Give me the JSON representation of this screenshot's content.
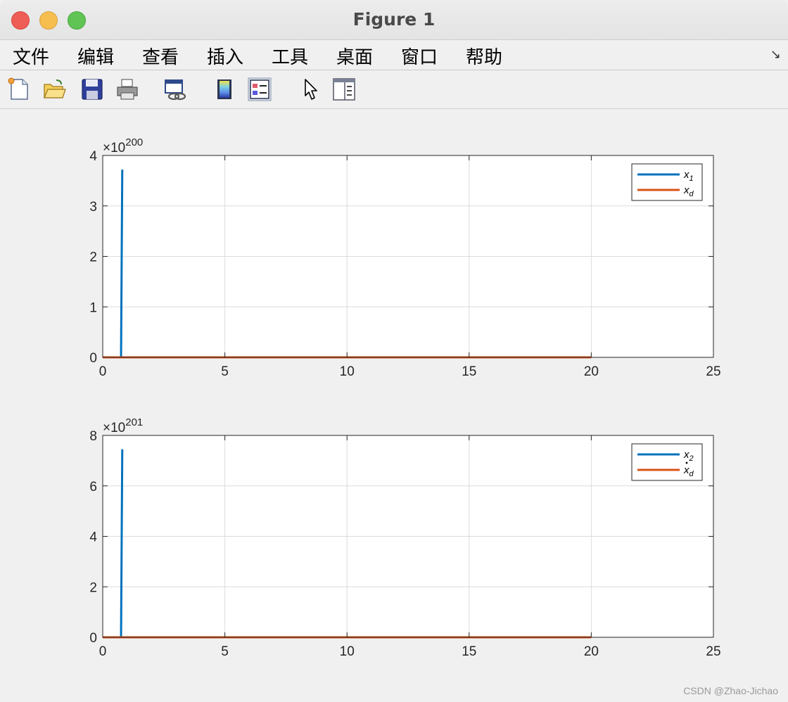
{
  "window": {
    "title": "Figure 1"
  },
  "menu": {
    "items": [
      "文件",
      "编辑",
      "查看",
      "插入",
      "工具",
      "桌面",
      "窗口",
      "帮助"
    ],
    "undock_icon": "undock-arrow-icon"
  },
  "toolbar": {
    "tools": [
      {
        "name": "new-figure-icon"
      },
      {
        "name": "open-file-icon"
      },
      {
        "name": "save-icon"
      },
      {
        "name": "print-icon"
      },
      {
        "name": "link-plot-icon"
      },
      {
        "name": "colorbar-icon"
      },
      {
        "name": "legend-icon"
      },
      {
        "name": "edit-plot-icon"
      },
      {
        "name": "property-inspector-icon"
      }
    ]
  },
  "colors": {
    "series1": "#0072bd",
    "series2": "#d95319",
    "grid": "#dcdcdc"
  },
  "watermark": "CSDN @Zhao-Jichao",
  "chart_data": [
    {
      "type": "line",
      "exponent_label": "×10",
      "exponent": "200",
      "xlim": [
        0,
        25
      ],
      "ylim": [
        0,
        4
      ],
      "xticks": [
        0,
        5,
        10,
        15,
        20,
        25
      ],
      "yticks": [
        0,
        1,
        2,
        3,
        4
      ],
      "grid": true,
      "legend_position": "top-right",
      "series": [
        {
          "name": "x",
          "sub": "1",
          "dot": false,
          "x": [
            0,
            0.75,
            0.8,
            0.8
          ],
          "y": [
            0,
            0,
            3.72,
            3.72
          ]
        },
        {
          "name": "x",
          "sub": "d",
          "dot": false,
          "x": [
            0,
            20
          ],
          "y": [
            0,
            0
          ]
        }
      ]
    },
    {
      "type": "line",
      "exponent_label": "×10",
      "exponent": "201",
      "xlim": [
        0,
        25
      ],
      "ylim": [
        0,
        8
      ],
      "xticks": [
        0,
        5,
        10,
        15,
        20,
        25
      ],
      "yticks": [
        0,
        2,
        4,
        6,
        8
      ],
      "grid": true,
      "legend_position": "top-right",
      "series": [
        {
          "name": "x",
          "sub": "2",
          "dot": false,
          "x": [
            0,
            0.75,
            0.8,
            0.8
          ],
          "y": [
            0,
            0,
            7.45,
            7.45
          ]
        },
        {
          "name": "x",
          "sub": "d",
          "dot": true,
          "x": [
            0,
            20
          ],
          "y": [
            0,
            0
          ]
        }
      ]
    }
  ]
}
